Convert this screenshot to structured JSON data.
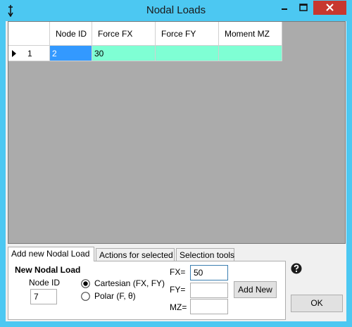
{
  "window": {
    "title": "Nodal Loads"
  },
  "grid": {
    "columns": [
      "Node ID",
      "Force FX",
      "Force FY",
      "Moment MZ"
    ],
    "rows": [
      {
        "row_number": "1",
        "node_id": "2",
        "force_fx": "30",
        "force_fy": "",
        "moment_mz": ""
      }
    ]
  },
  "tabs": [
    "Add new Nodal Load",
    "Actions for selected",
    "Selection tools"
  ],
  "form": {
    "heading": "New Nodal Load",
    "node_id_label": "Node ID",
    "node_id_value": "7",
    "radio_cartesian": "Cartesian (FX, FY)",
    "radio_polar": "Polar (F, θ)",
    "fx_label": "FX=",
    "fx_value": "50",
    "fy_label": "FY=",
    "fy_value": "",
    "mz_label": "MZ=",
    "mz_value": "",
    "add_button": "Add New"
  },
  "ok_button": "OK",
  "colors": {
    "title_bar": "#4cc8f2",
    "selected_cell": "#3399ff",
    "edited_cell": "#7fffd4",
    "close_button": "#c7372f"
  },
  "icons": {
    "app": "pin-icon",
    "help": "help-icon",
    "minimize": "minimize-icon",
    "maximize": "maximize-icon",
    "close": "close-icon"
  }
}
